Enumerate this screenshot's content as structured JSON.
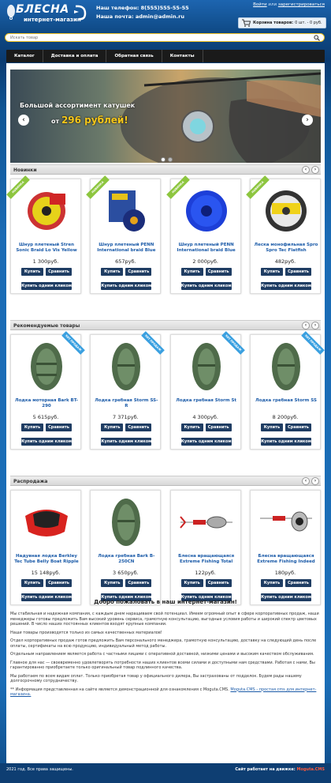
{
  "header": {
    "logo_title": "БЛЕСНА",
    "logo_subtitle": "интернет-магазин",
    "phone": "Наш телефон: 8(555)555-55-55",
    "email": "Наша почта: admin@admin.ru",
    "auth_login": "Войти",
    "auth_or": "или",
    "auth_register": "зарегистрироваться",
    "cart_label": "Корзина товаров:",
    "cart_value": "0 шт. - 0 руб."
  },
  "search": {
    "placeholder": "Искать товар"
  },
  "nav": {
    "items": [
      "Каталог",
      "Доставка и оплата",
      "Обратная связь",
      "Контакты"
    ]
  },
  "slider": {
    "line1": "Большой ассортимент катушек",
    "line2_prefix": "от",
    "price": "296 рублей!"
  },
  "sections": [
    {
      "title": "Новинки",
      "ribbon": "НОВИНКА",
      "products": [
        {
          "title": "Шнур плетеный Stren Sonic Braid Lo Vis Yellow",
          "price": "1 300руб."
        },
        {
          "title": "Шнур плетеный PENN International braid Blue",
          "price": "657руб."
        },
        {
          "title": "Шнур плетеный PENN International braid Blue",
          "price": "2 000руб."
        },
        {
          "title": "Леска монофильная Spro Spro Tec Flatfish",
          "price": "482руб."
        }
      ]
    },
    {
      "title": "Рекомендуемые товары",
      "ribbon": "ХИТ ПРОДАЖ",
      "products": [
        {
          "title": "Лодка моторная Bark BT-290",
          "price": "5 615руб."
        },
        {
          "title": "Лодка гребная Storm SS-R",
          "price": "7 371руб."
        },
        {
          "title": "Лодка гребная Storm St",
          "price": "4 300руб."
        },
        {
          "title": "Лодка гребная Storm SS",
          "price": "8 200руб."
        }
      ]
    },
    {
      "title": "Распродажа",
      "ribbon": "",
      "products": [
        {
          "title": "Надувная лодка Berkley Tec Tube Belly Boat Ripple",
          "price": "15 148руб."
        },
        {
          "title": "Лодка гребная Bark B-250CN",
          "price": "3 650руб."
        },
        {
          "title": "Блесна вращающаяся Extreme Fishing Total",
          "price": "122руб."
        },
        {
          "title": "Блесна вращающаяся Extreme Fishing Indeed",
          "price": "180руб."
        }
      ]
    }
  ],
  "buttons": {
    "buy": "Купить",
    "compare": "Сравнить",
    "one_click": "Купить одним кликом"
  },
  "welcome": "Добро пожаловать в наш интернет-магазин!",
  "about": {
    "p1": "Мы стабильная и надежная компания, с каждым днем наращиваем свой потенциал. Имеем огромный опыт в сфере корпоративных продаж, наши менеджеры готовы предложить Вам высокий уровень сервиса, грамотную консультацию, выгодные условия работы и широкий спектр цветовых решений. В число наших постоянных клиентов входят крупные компании.",
    "p2": "Наши товары производятся только из самых качественных материалов!",
    "p3": "Отдел корпоративных продаж готов предложить Вам персонального менеджера, грамотную консультацию, доставку на следующий день после оплаты, сертификаты на всю продукцию, индивидуальный метод работы.",
    "p4": "Отдельным направлением является работа с частными лицами с оперативной доставкой, низкими ценами и высоким качеством обслуживания.",
    "p5": "Главное для нас — своевременно удовлетворять потребности наших клиентов всеми силами и доступными нам средствами. Работая с нами, Вы гарантированно приобретаете только оригинальный товар подлинного качества.",
    "p6": "Мы работаем по всем видам оплат. Только приобретая товар у официального дилера, Вы застрахованы от подделок. Будем рады нашему долгосрочному сотрудничеству.",
    "note": "** Информация представленная на сайте является демонстрационной для ознакомления с Moguta.CMS.",
    "note_link": "Moguta.CMS - простая cms для интернет-магазина."
  },
  "footer": {
    "copyright": "2021 год. Все права защищены.",
    "engine_prefix": "Сайт работает на движке:",
    "engine_name": "Moguta.CMS"
  }
}
